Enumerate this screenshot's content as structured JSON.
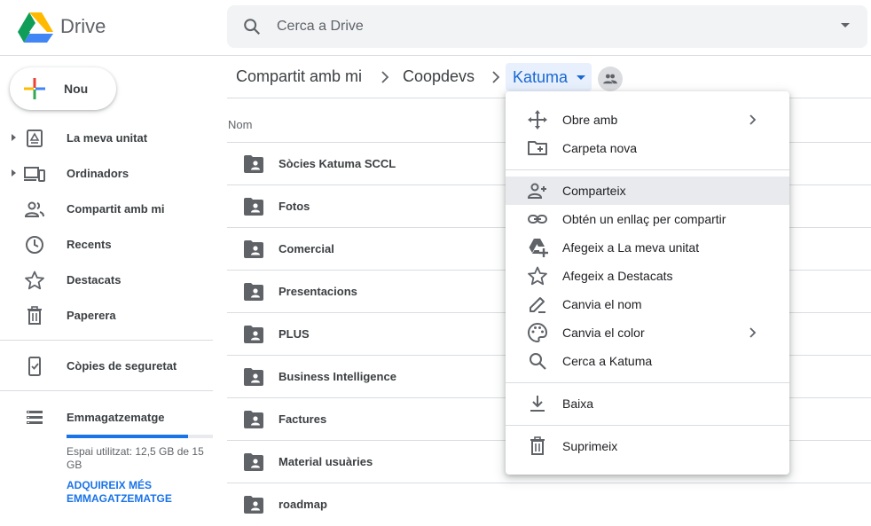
{
  "app": {
    "name": "Drive"
  },
  "search": {
    "placeholder": "Cerca a Drive"
  },
  "new_button": {
    "label": "Nou"
  },
  "sidebar": {
    "items": [
      {
        "label": "La meva unitat",
        "icon": "my-drive-icon"
      },
      {
        "label": "Ordinadors",
        "icon": "computers-icon"
      },
      {
        "label": "Compartit amb mi",
        "icon": "shared-with-me-icon"
      },
      {
        "label": "Recents",
        "icon": "clock-icon"
      },
      {
        "label": "Destacats",
        "icon": "star-icon"
      },
      {
        "label": "Paperera",
        "icon": "trash-icon"
      }
    ],
    "backups": {
      "label": "Còpies de seguretat"
    },
    "storage": {
      "label": "Emmagatzematge",
      "usage_text": "Espai utilitzat: 12,5 GB de 15 GB",
      "used_fraction": 0.83,
      "upgrade_link": "ADQUIREIX MÉS EMMAGATZEMATGE"
    }
  },
  "breadcrumb": {
    "items": [
      "Compartit amb mi",
      "Coopdevs"
    ],
    "current": "Katuma"
  },
  "file_list": {
    "column_name": "Nom",
    "rows": [
      "Sòcies Katuma SCCL",
      "Fotos",
      "Comercial",
      "Presentacions",
      "PLUS",
      "Business Intelligence",
      "Factures",
      "Material usuàries",
      "roadmap"
    ]
  },
  "context_menu": {
    "items": [
      {
        "label": "Obre amb",
        "icon": "move-arrows-icon",
        "submenu": true
      },
      {
        "label": "Carpeta nova",
        "icon": "new-folder-icon"
      },
      {
        "label": "Comparteix",
        "icon": "add-person-icon",
        "highlighted": true
      },
      {
        "label": "Obtén un enllaç per compartir",
        "icon": "link-icon"
      },
      {
        "label": "Afegeix a La meva unitat",
        "icon": "add-to-drive-icon"
      },
      {
        "label": "Afegeix a Destacats",
        "icon": "star-outline-icon"
      },
      {
        "label": "Canvia el nom",
        "icon": "pencil-icon"
      },
      {
        "label": "Canvia el color",
        "icon": "palette-icon",
        "submenu": true
      },
      {
        "label": "Cerca a Katuma",
        "icon": "search-icon"
      },
      {
        "label": "Baixa",
        "icon": "download-icon"
      },
      {
        "label": "Suprimeix",
        "icon": "trash-icon"
      }
    ]
  },
  "colors": {
    "accent": "#1a73e8",
    "highlight": "#e8f0fe",
    "icon_gray": "#5f6368"
  }
}
